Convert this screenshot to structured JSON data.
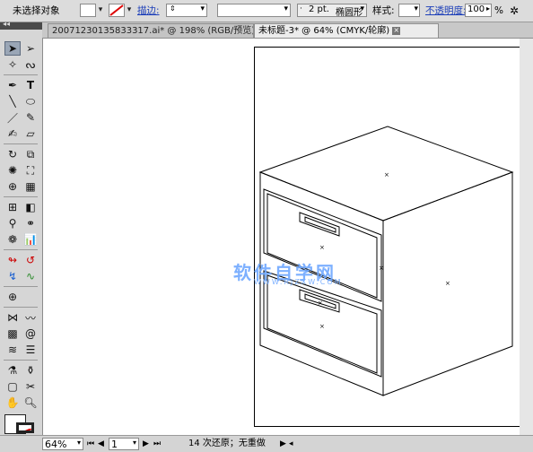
{
  "control_bar": {
    "selection_status": "未选择对象",
    "stroke_label": "描边:",
    "stroke_width": "2 pt.",
    "brush_label": "椭圆形",
    "style_label": "样式:",
    "opacity_label": "不透明度:",
    "opacity_value": "100",
    "opacity_unit": "%"
  },
  "tabs": [
    {
      "label": "20071230135833317.ai* @ 198% (RGB/预览)",
      "active": false
    },
    {
      "label": "未标题-3* @ 64% (CMYK/轮廓)",
      "active": true
    }
  ],
  "watermark": {
    "main": "软件自学网",
    "sub": "WWW.RJZXW.COM"
  },
  "status_bar": {
    "zoom": "64%",
    "page": "1",
    "history": "14 次还原；无重做"
  },
  "colors": {
    "accent_link": "#1a3db8",
    "toolbox_bg": "#d6d6d6",
    "canvas_bg": "#ffffff"
  }
}
